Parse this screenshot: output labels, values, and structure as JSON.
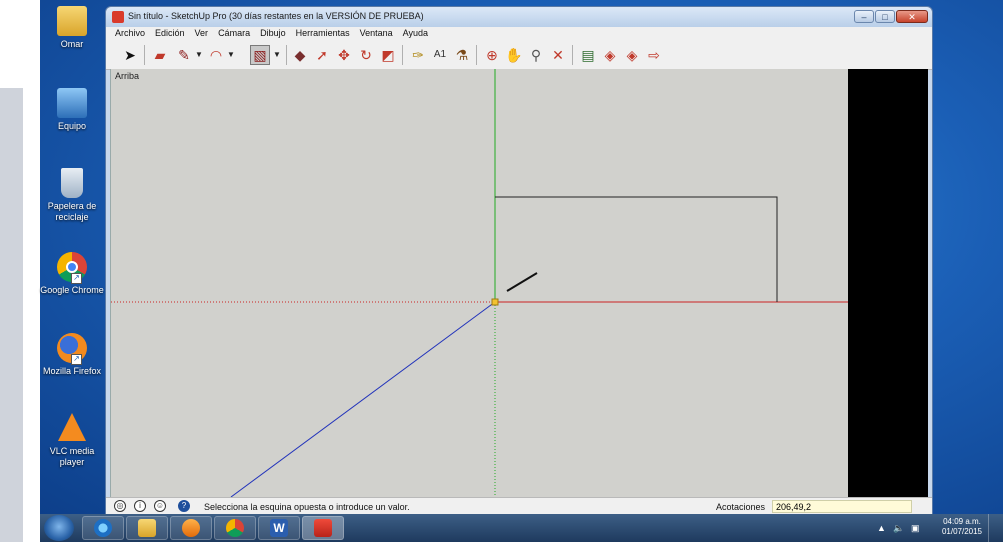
{
  "desktop": {
    "icons": [
      {
        "label": "Omar",
        "icon": "folder-icon"
      },
      {
        "label": "Equipo",
        "icon": "computer-icon"
      },
      {
        "label": "Papelera de reciclaje",
        "icon": "recycle-bin-icon"
      },
      {
        "label": "Google Chrome",
        "icon": "chrome-icon"
      },
      {
        "label": "Mozilla Firefox",
        "icon": "firefox-icon"
      },
      {
        "label": "VLC media player",
        "icon": "vlc-icon"
      }
    ]
  },
  "window": {
    "title": "Sin título - SketchUp Pro (30 días restantes en la VERSIÓN DE PRUEBA)",
    "menu": [
      "Archivo",
      "Edición",
      "Ver",
      "Cámara",
      "Dibujo",
      "Herramientas",
      "Ventana",
      "Ayuda"
    ],
    "toolbar": [
      "select-icon",
      "eraser-icon",
      "pencil-icon",
      "arc-icon",
      "rectangle-icon",
      "push-pull-icon",
      "follow-me-icon",
      "move-icon",
      "rotate-icon",
      "scale-icon",
      "tape-measure-icon",
      "text-icon",
      "paint-bucket-icon",
      "orbit-icon",
      "pan-icon",
      "zoom-icon",
      "zoom-extents-icon",
      "components-icon",
      "warehouse-icon",
      "share-model-icon",
      "extension-icon"
    ],
    "viewport": {
      "view_label": "Arriba"
    },
    "status": {
      "message": "Selecciona la esquina opuesta o introduce un valor.",
      "dimensions_label": "Acotaciones",
      "dimensions_value": "206,49,2"
    }
  },
  "taskbar": {
    "apps": [
      "internet-explorer-icon",
      "file-explorer-icon",
      "media-player-icon",
      "chrome-icon",
      "word-icon",
      "sketchup-icon"
    ],
    "active_app": "sketchup-icon",
    "clock_time": "04:09 a.m.",
    "clock_date": "01/07/2015"
  },
  "colors": {
    "x_axis": "#cc2222",
    "y_axis": "#22aa22",
    "z_axis": "#2233bb",
    "viewport_bg": "#d1d1cd"
  }
}
